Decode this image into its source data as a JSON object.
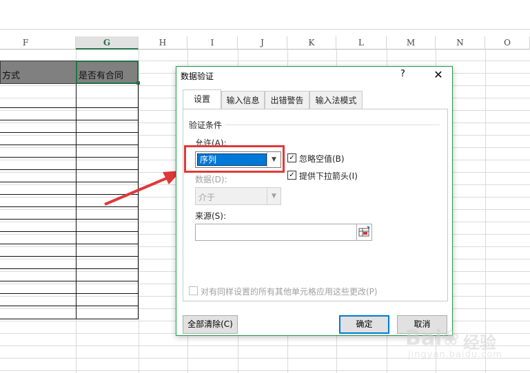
{
  "sheet": {
    "columns": [
      {
        "name": "F",
        "selected": false
      },
      {
        "name": "G",
        "selected": true
      },
      {
        "name": "H",
        "selected": false
      },
      {
        "name": "I",
        "selected": false
      },
      {
        "name": "J",
        "selected": false
      },
      {
        "name": "K",
        "selected": false
      },
      {
        "name": "L",
        "selected": false
      },
      {
        "name": "M",
        "selected": false
      },
      {
        "name": "N",
        "selected": false
      },
      {
        "name": "O",
        "selected": false
      }
    ],
    "header_cells": {
      "f": "方式",
      "g": "是否有合同"
    },
    "header_fill": "#808080",
    "selection_color": "#217346"
  },
  "annotation": {
    "arrow_color": "#e0383a"
  },
  "dialog": {
    "title": "数据验证",
    "help": "?",
    "close": "✕",
    "tabs": [
      "设置",
      "输入信息",
      "出错警告",
      "输入法模式"
    ],
    "active_tab": 0,
    "group_title": "验证条件",
    "allow_label": "允许(A):",
    "allow_value": "序列",
    "ignore_blank": {
      "label": "忽略空值(B)",
      "checked": true
    },
    "dropdown_arrow": {
      "label": "提供下拉箭头(I)",
      "checked": true
    },
    "data_label": "数据(D):",
    "data_value": "介于",
    "source_label": "来源(S):",
    "source_value": "",
    "apply_all": {
      "label": "对有同样设置的所有其他单元格应用这些更改(P)",
      "checked": false
    },
    "clear_all": "全部清除(C)",
    "ok": "确定",
    "cancel": "取消",
    "border_color": "#1e9c4a",
    "highlight_color": "#e0383a",
    "selected_bg": "#0078d7"
  },
  "watermark": {
    "logo": "Bai",
    "logo2": "经验",
    "url": "jingyan.baidu.com"
  }
}
